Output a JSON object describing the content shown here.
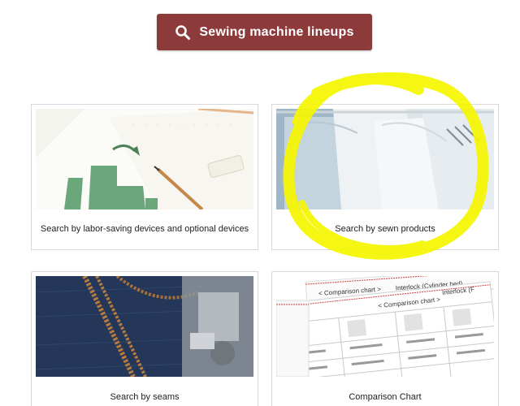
{
  "header": {
    "lineup_button_label": "Sewing machine lineups",
    "button_color": "#8c3a3a"
  },
  "cards": [
    {
      "caption": "Search by labor-saving devices and optional devices",
      "image": "chart-papers-with-pencil"
    },
    {
      "caption": "Search by sewn products",
      "image": "shirts-on-hangers"
    },
    {
      "caption": "Search by seams",
      "image": "denim-seams-closeup"
    },
    {
      "caption": "Comparison Chart",
      "image": "comparison-chart-sheets"
    }
  ],
  "comparison_thumb": {
    "sheet_title_1": "< Comparison chart >",
    "sheet_sub_1": "Interlock (Cylinder bed)",
    "sheet_title_2": "< Comparison chart >",
    "sheet_sub_2": "Interlock (F"
  },
  "annotation": {
    "color": "#ffff00",
    "shape": "circle-scribble"
  }
}
